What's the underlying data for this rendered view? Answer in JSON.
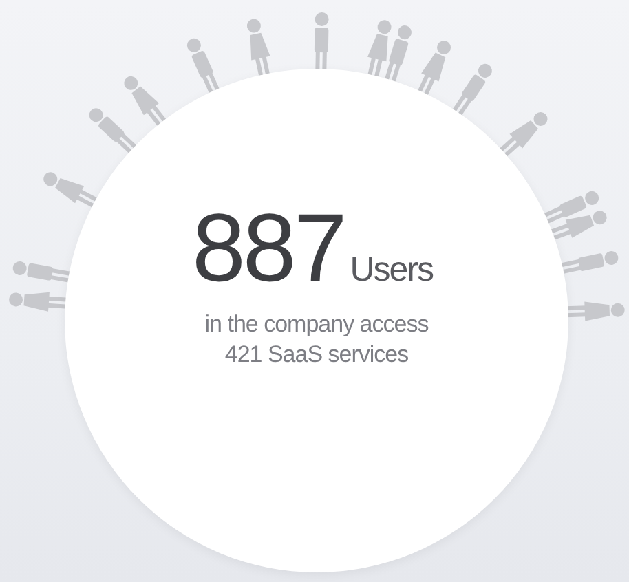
{
  "stat": {
    "value": "887",
    "unit": "Users",
    "lines": [
      "in the company access",
      "421 SaaS services"
    ]
  }
}
